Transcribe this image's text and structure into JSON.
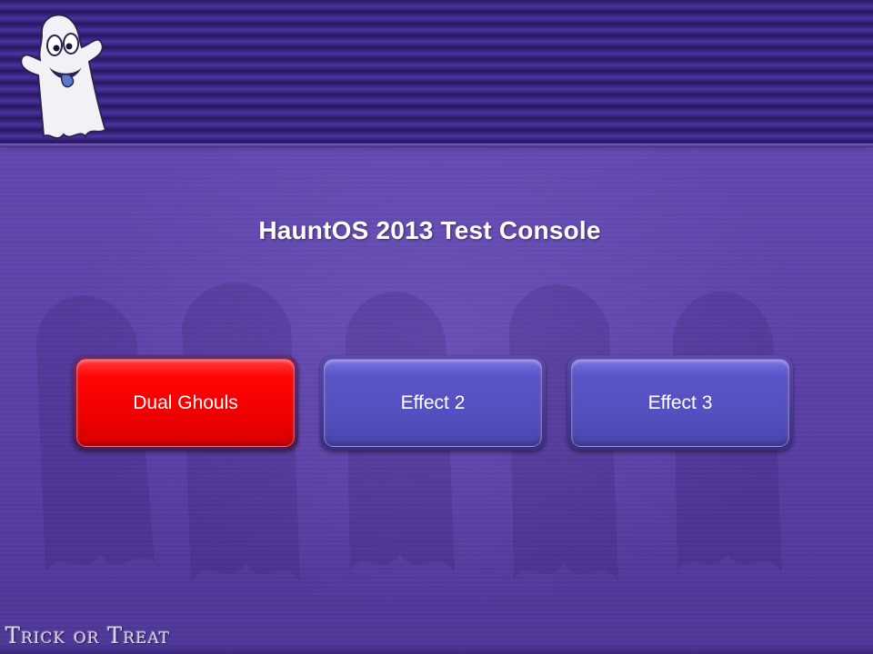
{
  "app": {
    "title": "HauntOS 2013 Test Console"
  },
  "effects": [
    {
      "label": "Dual Ghouls",
      "active": true
    },
    {
      "label": "Effect 2",
      "active": false
    },
    {
      "label": "Effect 3",
      "active": false
    }
  ],
  "branding": {
    "footer_logo_text": "Trick or Treat",
    "mascot_icon": "ghost-icon"
  },
  "colors": {
    "background": "#5a3c9e",
    "banner": "#3a2582",
    "button_default": "#5c55c9",
    "button_active": "#ff0606",
    "title_text": "#ffffff"
  }
}
